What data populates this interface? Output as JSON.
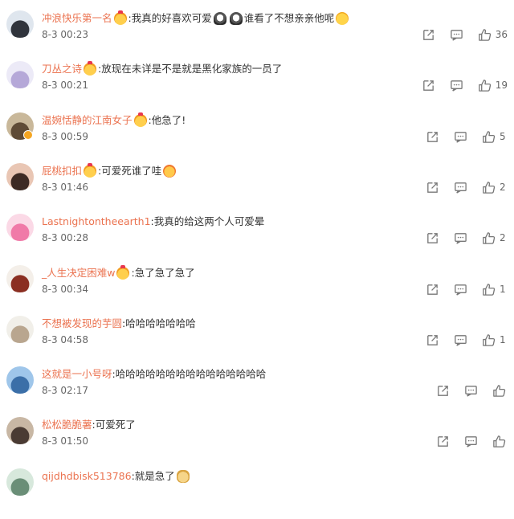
{
  "comments": [
    {
      "user": "冲浪快乐第一名",
      "segments": [
        {
          "type": "emoji",
          "icon": "crown-emoji-icon"
        },
        {
          "type": "text",
          "text": ":我真的好喜欢可爱"
        },
        {
          "type": "emoji",
          "icon": "ghost-emoji-icon"
        },
        {
          "type": "emoji",
          "icon": "ghost-emoji-icon"
        },
        {
          "type": "text",
          "text": " 谁看了不想亲亲他呢"
        },
        {
          "type": "emoji",
          "icon": "crying-emoji-icon"
        }
      ],
      "time": "8-3 00:23",
      "likes": "36",
      "avatar": [
        "#dfe6ee",
        "#30343c"
      ],
      "verified": false
    },
    {
      "user": "刀丛之诗",
      "segments": [
        {
          "type": "emoji",
          "icon": "crown-emoji-icon"
        },
        {
          "type": "text",
          "text": ":放现在未详是不是就是黑化家族的一员了"
        }
      ],
      "time": "8-3 00:21",
      "likes": "19",
      "avatar": [
        "#eceaf7",
        "#b5a8d8"
      ],
      "verified": false
    },
    {
      "user": "温婉恬静的江南女子",
      "segments": [
        {
          "type": "emoji",
          "icon": "crown-emoji-icon"
        },
        {
          "type": "text",
          "text": ":他急了!"
        }
      ],
      "time": "8-3 00:59",
      "likes": "5",
      "avatar": [
        "#c9b89a",
        "#5f4b36"
      ],
      "verified": true
    },
    {
      "user": "屁桃扣扣",
      "segments": [
        {
          "type": "emoji",
          "icon": "crown-emoji-icon"
        },
        {
          "type": "text",
          "text": ":可爱死谁了哇"
        },
        {
          "type": "emoji",
          "icon": "heart-eyes-emoji-icon"
        }
      ],
      "time": "8-3 01:46",
      "likes": "2",
      "avatar": [
        "#e9c6b4",
        "#3d2a24"
      ],
      "verified": false
    },
    {
      "user": "Lastnightontheearth1",
      "segments": [
        {
          "type": "text",
          "text": ":我真的给这两个人可爱晕"
        }
      ],
      "time": "8-3 00:28",
      "likes": "2",
      "avatar": [
        "#fbd9e6",
        "#f07aa8"
      ],
      "verified": false
    },
    {
      "user": "_人生决定困难w",
      "segments": [
        {
          "type": "emoji",
          "icon": "crown-emoji-icon"
        },
        {
          "type": "text",
          "text": ":急了急了急了"
        }
      ],
      "time": "8-3 00:34",
      "likes": "1",
      "avatar": [
        "#f4efe9",
        "#8b2f22"
      ],
      "verified": false
    },
    {
      "user": "不想被发现的芋圆",
      "segments": [
        {
          "type": "text",
          "text": ":哈哈哈哈哈哈哈"
        }
      ],
      "time": "8-3 04:58",
      "likes": "1",
      "avatar": [
        "#f1efe9",
        "#b9a68f"
      ],
      "verified": false
    },
    {
      "user": "这就是一小号呀",
      "segments": [
        {
          "type": "text",
          "text": ":哈哈哈哈哈哈哈哈哈哈哈哈哈哈哈"
        }
      ],
      "time": "8-3 02:17",
      "likes": "",
      "avatar": [
        "#9fc6ea",
        "#3b6fa8"
      ],
      "verified": false
    },
    {
      "user": "松松脆脆薯",
      "segments": [
        {
          "type": "text",
          "text": ":可爱死了"
        }
      ],
      "time": "8-3 01:50",
      "likes": "",
      "avatar": [
        "#c8b7a4",
        "#4a3b33"
      ],
      "verified": false
    },
    {
      "user": "qijdhdbisk513786",
      "segments": [
        {
          "type": "text",
          "text": ":就是急了"
        },
        {
          "type": "emoji",
          "icon": "dog-emoji-icon"
        }
      ],
      "time": "",
      "likes": "",
      "avatar": [
        "#d7e8dc",
        "#6a8e77"
      ],
      "verified": false
    }
  ],
  "icons": {
    "share": "share-icon",
    "reply": "comment-icon",
    "like": "thumbs-up-icon"
  },
  "colors": {
    "username": "#eb7350",
    "text": "#333333",
    "meta": "#666666"
  }
}
